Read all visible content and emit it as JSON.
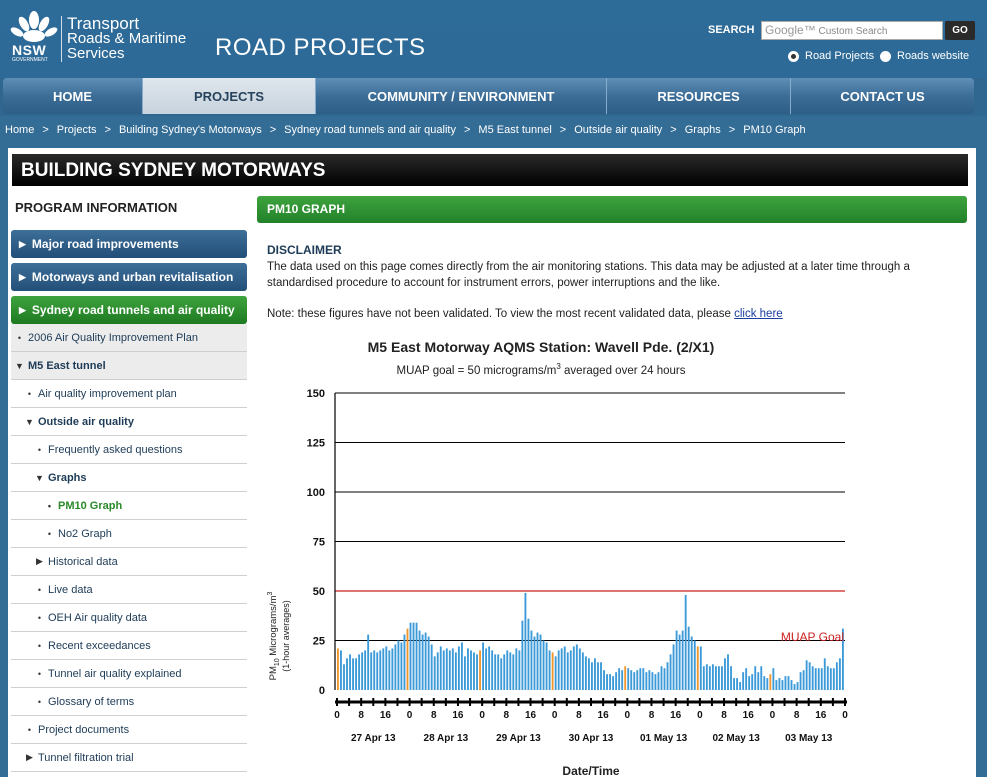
{
  "header": {
    "logo_text": [
      "Transport",
      "Roads & Maritime",
      "Services"
    ],
    "logo_nsw": "NSW",
    "logo_gov": "GOVERNMENT",
    "site_title": "ROAD PROJECTS",
    "search_label": "SEARCH",
    "search_placeholder": "Custom Search",
    "search_brand": "Google™",
    "go_label": "GO",
    "radio_road_projects": "Road Projects",
    "radio_roads_website": "Roads website"
  },
  "nav": [
    {
      "label": "HOME"
    },
    {
      "label": "PROJECTS"
    },
    {
      "label": "COMMUNITY / ENVIRONMENT"
    },
    {
      "label": "RESOURCES"
    },
    {
      "label": "CONTACT US"
    }
  ],
  "breadcrumb": [
    "Home",
    "Projects",
    "Building Sydney's Motorways",
    "Sydney road tunnels and air quality",
    "M5 East tunnel",
    "Outside air quality",
    "Graphs",
    "PM10 Graph"
  ],
  "page_title": "BUILDING SYDNEY MOTORWAYS",
  "sidebar": {
    "title": "PROGRAM INFORMATION",
    "main_items": [
      "Major road improvements",
      "Motorways and urban revitalisation",
      "Sydney road tunnels and air quality"
    ],
    "items": [
      {
        "label": "2006 Air Quality Improvement Plan",
        "marker": "•"
      },
      {
        "label": "M5 East tunnel",
        "marker": "▼"
      },
      {
        "label": "Air quality improvement plan",
        "marker": "•"
      },
      {
        "label": "Outside air quality",
        "marker": "▼"
      },
      {
        "label": "Frequently asked questions",
        "marker": "•"
      },
      {
        "label": "Graphs",
        "marker": "▼"
      },
      {
        "label": "PM10 Graph",
        "marker": "•"
      },
      {
        "label": "No2 Graph",
        "marker": "•"
      },
      {
        "label": "Historical data",
        "marker": "▶"
      },
      {
        "label": "Live data",
        "marker": "•"
      },
      {
        "label": "OEH Air quality data",
        "marker": "•"
      },
      {
        "label": "Recent exceedances",
        "marker": "•"
      },
      {
        "label": "Tunnel air quality explained",
        "marker": "•"
      },
      {
        "label": "Glossary of terms",
        "marker": "•"
      },
      {
        "label": "Project documents",
        "marker": "•"
      },
      {
        "label": "Tunnel filtration trial",
        "marker": "▶"
      }
    ]
  },
  "content": {
    "section_title": "PM10 GRAPH",
    "disclaimer_title": "DISCLAIMER",
    "disclaimer_body": "The data used on this page comes directly from the air monitoring stations. This data may be adjusted at a later time through a standardised procedure to account for instrument errors, power interruptions and the like.",
    "note": "Note: these figures have not been validated. To view the most recent validated data, please ",
    "note_link": "click here"
  },
  "chart_data": {
    "type": "bar",
    "title": "M5 East Motorway AQMS Station: Wavell Pde. (2/X1)",
    "subtitle_pre": "MUAP goal = 50 micrograms/m",
    "subtitle_sup": "3",
    "subtitle_post": " averaged over 24 hours",
    "ylabel_pre": "PM",
    "ylabel_sub": "10",
    "ylabel_mid": " Micrograms/m",
    "ylabel_sup": "3",
    "ylabel_line2": "(1-hour averages)",
    "xlabel": "Date/Time",
    "ylim": [
      0,
      150
    ],
    "yticks": [
      0,
      25,
      50,
      75,
      100,
      125,
      150
    ],
    "goal_value": 50,
    "goal_label": "MUAP Goal",
    "hour_ticks": [
      "0",
      "8",
      "16",
      "0",
      "8",
      "16",
      "0",
      "8",
      "16",
      "0",
      "8",
      "16",
      "0",
      "8",
      "16",
      "0",
      "8",
      "16",
      "0",
      "8",
      "16",
      "0"
    ],
    "dates": [
      "27 Apr 13",
      "28 Apr 13",
      "29 Apr 13",
      "30 Apr 13",
      "01 May 13",
      "02 May 13",
      "03 May 13"
    ],
    "bar_color": "#3c9ad8",
    "highlight_color": "#f0962c",
    "goal_color": "#cc2222",
    "values": [
      21,
      20,
      13,
      16,
      18,
      16,
      16,
      18,
      19,
      20,
      28,
      19,
      20,
      19,
      20,
      21,
      22,
      20,
      21,
      23,
      25,
      24,
      28,
      31,
      34,
      34,
      34,
      30,
      28,
      29,
      27,
      23,
      17,
      19,
      22,
      20,
      21,
      20,
      21,
      19,
      22,
      24,
      17,
      21,
      20,
      19,
      18,
      20,
      24,
      21,
      22,
      20,
      18,
      18,
      16,
      18,
      20,
      19,
      18,
      21,
      20,
      35,
      49,
      36,
      30,
      27,
      29,
      28,
      25,
      24,
      20,
      19,
      17,
      20,
      21,
      22,
      19,
      20,
      22,
      23,
      21,
      19,
      17,
      16,
      14,
      16,
      14,
      14,
      10,
      8,
      8,
      7,
      9,
      11,
      10,
      12,
      11,
      10,
      9,
      10,
      11,
      11,
      9,
      10,
      9,
      8,
      9,
      12,
      11,
      14,
      18,
      23,
      30,
      28,
      30,
      48,
      32,
      27,
      25,
      22,
      22,
      12,
      13,
      12,
      13,
      12,
      12,
      12,
      16,
      18,
      12,
      6,
      6,
      4,
      9,
      11,
      7,
      8,
      12,
      9,
      12,
      7,
      6,
      8,
      11,
      5,
      6,
      5,
      7,
      7,
      5,
      3,
      4,
      9,
      10,
      15,
      14,
      12,
      11,
      11,
      11,
      16,
      12,
      11,
      11,
      14,
      16,
      31
    ],
    "highlight_indices": [
      0,
      23,
      47,
      71,
      95,
      119,
      143
    ]
  }
}
